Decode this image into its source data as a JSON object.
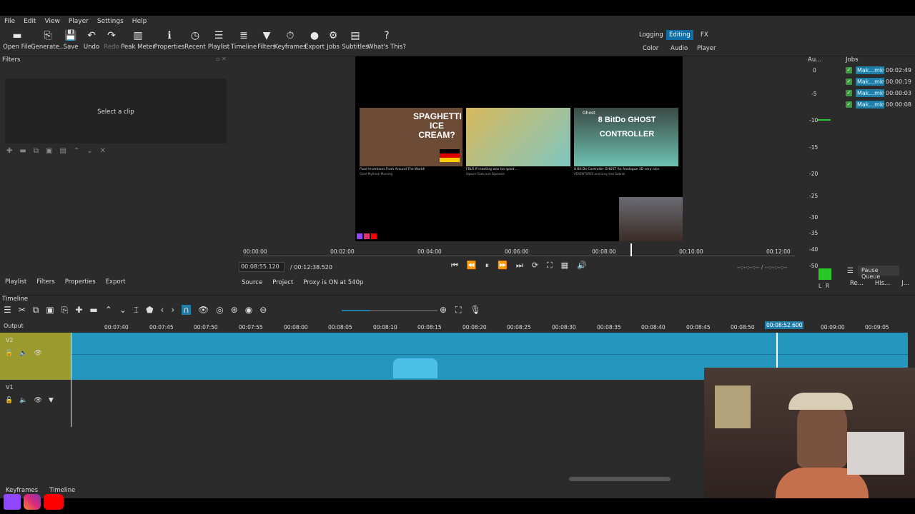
{
  "menu": [
    "File",
    "Edit",
    "View",
    "Player",
    "Settings",
    "Help"
  ],
  "toolbar": [
    {
      "label": "Open File",
      "icon": "▬",
      "name": "open-file-icon"
    },
    {
      "label": "Generate...",
      "icon": "⎘",
      "name": "generate-icon"
    },
    {
      "label": "Save",
      "icon": "💾",
      "name": "save-icon"
    },
    {
      "label": "Undo",
      "icon": "↶",
      "name": "undo-icon"
    },
    {
      "label": "Redo",
      "icon": "↷",
      "name": "redo-icon"
    },
    {
      "label": "Peak Meter",
      "icon": "▥",
      "name": "peak-meter-icon"
    },
    {
      "label": "Properties",
      "icon": "ℹ",
      "name": "properties-icon"
    },
    {
      "label": "Recent",
      "icon": "◷",
      "name": "recent-icon"
    },
    {
      "label": "Playlist",
      "icon": "☰",
      "name": "playlist-icon"
    },
    {
      "label": "Timeline",
      "icon": "≣",
      "name": "timeline-icon"
    },
    {
      "label": "Filters",
      "icon": "▼",
      "name": "filters-icon"
    },
    {
      "label": "Keyframes",
      "icon": "⏱",
      "name": "keyframes-icon"
    },
    {
      "label": "Export",
      "icon": "●",
      "name": "export-icon"
    },
    {
      "label": "Jobs",
      "icon": "⚙",
      "name": "jobs-icon"
    },
    {
      "label": "Subtitles",
      "icon": "▤",
      "name": "subtitles-icon"
    },
    {
      "label": "What's This?",
      "icon": "?",
      "name": "whats-this-icon"
    }
  ],
  "layouts": {
    "logging": "Logging",
    "editing": "Editing",
    "fx": "FX",
    "color": "Color",
    "audio": "Audio",
    "player": "Player"
  },
  "filters": {
    "title": "Filters",
    "select_clip": "Select a clip"
  },
  "audio_meter": {
    "title": "Au...",
    "scale": [
      "0",
      "-5",
      "-10",
      "-15",
      "-20",
      "-25",
      "-30",
      "-35",
      "-40",
      "-50"
    ],
    "channels": [
      "L",
      "R"
    ]
  },
  "jobs": {
    "title": "Jobs",
    "items": [
      {
        "name": "Mak...mkv",
        "time": "00:02:49"
      },
      {
        "name": "Mak...mkv",
        "time": "00:00:19"
      },
      {
        "name": "Mak...mkv",
        "time": "00:00:03"
      },
      {
        "name": "Mak...mkv",
        "time": "00:00:08"
      }
    ],
    "pause_queue": "Pause Queue",
    "tabs": [
      "Re...",
      "His...",
      "J..."
    ]
  },
  "preview": {
    "thumbs": [
      {
        "title_overlay": "SPAGHETTI ICE CREAM?",
        "caption": "Food Inventions From Around The World!",
        "sub": "Good Mythical Morning"
      },
      {
        "title_overlay": "",
        "caption": "FBLR ff meeting was too good...",
        "sub": "Sqaure Gods and Squeezie"
      },
      {
        "title_overlay": "8 BitDo GHOST CONTROLLER",
        "caption": "8 Bit Do Controller GHOST for Analogue 3D very nice",
        "sub": "ADVENTURES and Gray and Gabriel"
      }
    ],
    "ghost_label": "Ghost"
  },
  "ruler": {
    "labels": [
      "00:00:00",
      "00:02:00",
      "00:04:00",
      "00:06:00",
      "00:08:00",
      "00:10:00",
      "00:12:00"
    ],
    "playhead_fraction": 0.7
  },
  "transport": {
    "current": "00:08:55.120",
    "total": "/ 00:12:38.520",
    "inout": "--:--:--:-- / --:--:--:--"
  },
  "bottom_tabs_left": [
    "Playlist",
    "Filters",
    "Properties",
    "Export"
  ],
  "source_tabs": [
    "Source",
    "Project"
  ],
  "proxy": "Proxy is ON at 540p",
  "timeline": {
    "title": "Timeline",
    "output": "Output",
    "tracks": [
      "V2",
      "V1"
    ],
    "ticks": [
      "00:07:40",
      "00:07:45",
      "00:07:50",
      "00:07:55",
      "00:08:00",
      "00:08:05",
      "00:08:10",
      "00:08:15",
      "00:08:20",
      "00:08:25",
      "00:08:30",
      "00:08:35",
      "00:08:40",
      "00:08:45",
      "00:08:50",
      "00:09:00",
      "00:09:05"
    ],
    "playhead": "00:08:52.600"
  },
  "bottom_tabs": [
    "Keyframes",
    "Timeline"
  ],
  "colors": {
    "accent": "#0f6ea6",
    "clip": "#2596be",
    "track_head": "#9a9a2e",
    "meter": "#28c828"
  }
}
